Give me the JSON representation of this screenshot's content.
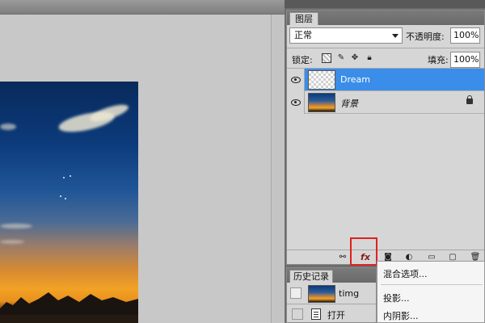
{
  "layers_panel": {
    "tab_label": "图层",
    "blend_mode": "正常",
    "opacity_label": "不透明度:",
    "opacity_value": "100%",
    "lock_label": "锁定:",
    "fill_label": "填充:",
    "fill_value": "100%",
    "layers": [
      {
        "name": "Dream",
        "selected": true,
        "thumbnail": "transparent"
      },
      {
        "name": "背景",
        "selected": false,
        "thumbnail": "sunset",
        "locked": true
      }
    ],
    "footer_icons": [
      "link-icon",
      "fx-icon",
      "mask-icon",
      "adjustment-icon",
      "group-folder-icon",
      "new-layer-icon",
      "trash-icon"
    ],
    "fx_label": "fx"
  },
  "history_panel": {
    "tab_label": "历史记录",
    "snapshot_name": "timg",
    "step_name": "打开"
  },
  "fx_menu": {
    "items": [
      "混合选项...",
      "投影...",
      "内阴影..."
    ]
  },
  "colors": {
    "selection": "#3a8de8",
    "highlight_box": "#e02020",
    "panel_bg": "#d6d6d6"
  }
}
